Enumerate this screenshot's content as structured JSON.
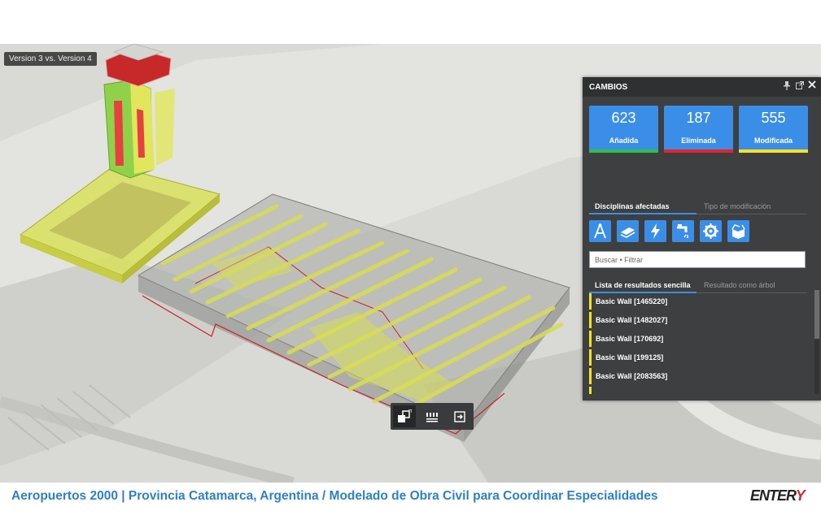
{
  "viewer": {
    "version_label": "Version 3 vs. Version 4"
  },
  "panel": {
    "title": "CAMBIOS",
    "stats": [
      {
        "value": "623",
        "label": "Añadida",
        "color": "#2fbf4a"
      },
      {
        "value": "187",
        "label": "Eliminada",
        "color": "#e8232a"
      },
      {
        "value": "555",
        "label": "Modificada",
        "color": "#f5e425"
      }
    ],
    "tabs_top": [
      "Disciplinas afectadas",
      "Tipo de modificación"
    ],
    "disciplines": [
      "architecture-icon",
      "structure-icon",
      "electrical-icon",
      "plumbing-icon",
      "mechanical-icon",
      "generic-icon"
    ],
    "search_placeholder": "Buscar • Filtrar",
    "tabs_results": [
      "Lista de resultados sencilla",
      "Resultado como árbol"
    ],
    "results": [
      "Basic Wall [1465220]",
      "Basic Wall [1482027]",
      "Basic Wall [170692]",
      "Basic Wall [199125]",
      "Basic Wall [2083563]"
    ]
  },
  "toolbar": {
    "tools": [
      "compare-icon",
      "list-icon",
      "exit-icon"
    ]
  },
  "footer": {
    "caption": "Aeropuertos 2000 | Provincia Catamarca, Argentina  / Modelado de Obra Civil para Coordinar Especialidades",
    "logo_text": "ENTER",
    "logo_mark": "Y"
  }
}
